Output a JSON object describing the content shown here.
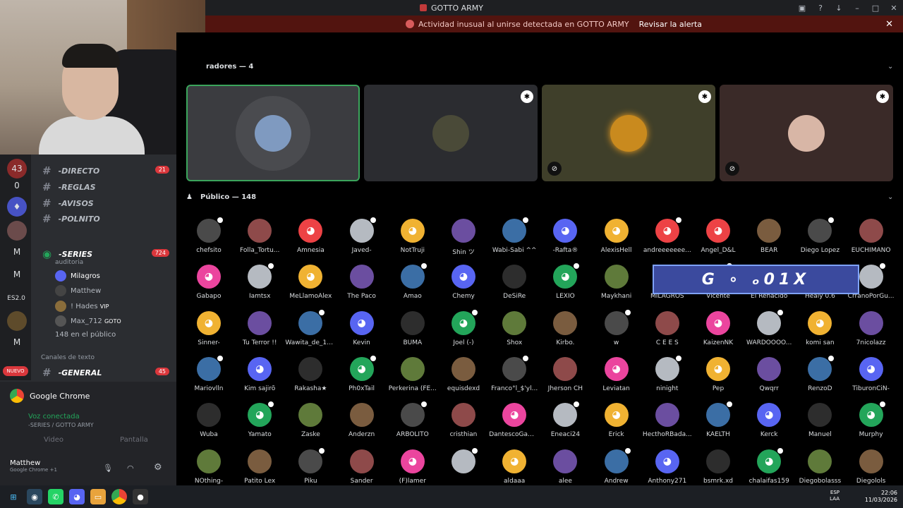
{
  "window": {
    "title": "GOTTO ARMY"
  },
  "alert": {
    "text": "Actividad inusual al unirse detectada en GOTTO ARMY",
    "action": "Revisar la alerta"
  },
  "servers": [
    {
      "label": "43"
    },
    {
      "label": "0"
    },
    {
      "label": "M"
    },
    {
      "label": "M"
    },
    {
      "label": "ES2.0"
    },
    {
      "label": "M"
    },
    {
      "label": "NUEVO"
    }
  ],
  "channels": {
    "directo": "-DIRECTO",
    "directo_count": "21",
    "reglas": "-REGLAS",
    "avisos": "-AVISOS",
    "polnito": "-POLNITO",
    "series": "-SERIES",
    "series_count": "724",
    "series_sub": "auditoria",
    "members": [
      "Milagros",
      "Matthew",
      "! Hades",
      "Max_712"
    ],
    "hades_tag": "VIP",
    "max_tag": "GOTO",
    "public_count_text": "148 en el público",
    "text_section": "Canales de texto",
    "general": "-GENERAL",
    "general_count": "45"
  },
  "voice_panel": {
    "app": "Google Chrome",
    "status": "Voz conectada",
    "channel": "-SERIES / GOTTO ARMY",
    "video": "Video",
    "screen": "Pantalla",
    "user": "Matthew",
    "user_status": "Google Chrome +1"
  },
  "stage": {
    "speakers_header": "radores — 4",
    "public_header": "Público — 148"
  },
  "audience": [
    "chefsito",
    "Folla_Tortu...",
    "Amnesia",
    "Javed-",
    "NotTruji",
    "Shin ツ",
    "Wabi-Sabi ^^",
    "-Rafta®",
    "AlexisHell",
    "andreeeeeee...",
    "Angel_D&L",
    "BEAR",
    "Diego Lopez",
    "EUCHIMANO",
    "Gabapo",
    "Iamtsx",
    "MeLlamoAlex",
    "The Paco",
    "Amao",
    "Chemy",
    "DeSiRe",
    "LEXIO",
    "Maykhani",
    "MILAGROS",
    "Vicente",
    "El Renacido",
    "Healy 0.6",
    "CrranoPorGu...",
    "Sinner-",
    "Tu Terror !!",
    "Wawita_de_17...",
    "Kevin",
    "BUMA",
    "Joel (-)",
    "Shox",
    "Kirbo.",
    "w",
    "C E E S",
    "KaizenNK",
    "WARDOOOO...",
    "komi san",
    "7nicolazz",
    "Mariovlln",
    "Kim sajirõ",
    "Rakasha★",
    "Ph0xTail",
    "Perkerina (FE...",
    "equisdexd",
    "Franco°l_$'yl...",
    "Jherson CH",
    "Leviatan",
    "ninight",
    "Pep",
    "Qwqrr",
    "RenzoD",
    "TiburonCiN-",
    "Wuba",
    "Yamato",
    "Zaske",
    "Anderzn",
    "ARBOLITO",
    "cristhian",
    "DantescoGam...",
    "Eneaci24",
    "Erick",
    "HecthoRBada...",
    "KAELTH",
    "Kerck",
    "Manuel",
    "Murphy",
    "NOthing-",
    "Patito Lex",
    "Piku",
    "Sander",
    "(F)lamer",
    "",
    "aldaaa",
    "alee",
    "Andrew",
    "Anthony271",
    "bsmrk.xd",
    "chalaifas159",
    "Diegobolasss",
    "Diegolols"
  ],
  "overlay_text": "G ∘ ₒ01X",
  "tray": {
    "lang": "ESP",
    "lang2": "LAA",
    "time": "22:06",
    "date": "11/03/2026"
  },
  "colors": {
    "accent": "#5865f2",
    "alert_bg": "#52140f",
    "online": "#23a55a"
  }
}
